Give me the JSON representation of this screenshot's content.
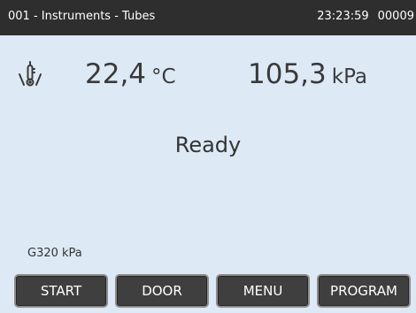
{
  "header": {
    "title": "001 - Instruments - Tubes",
    "time": "23:23:59",
    "counter": "00009"
  },
  "readings": {
    "sensor_icon": "temperature-sensor-icon",
    "temperature_value": "22,4",
    "temperature_unit": "°C",
    "pressure_value": "105,3",
    "pressure_unit": "kPa"
  },
  "status": {
    "text": "Ready"
  },
  "parameter": {
    "text": "G320 kPa"
  },
  "softkeys": [
    {
      "label": "START"
    },
    {
      "label": "DOOR"
    },
    {
      "label": "MENU"
    },
    {
      "label": "PROGRAM"
    }
  ],
  "colors": {
    "title_bar": "#2e2e2e",
    "background": "#dde9f5",
    "button_face": "#3f3f3f",
    "button_border": "#8d8d8d"
  }
}
